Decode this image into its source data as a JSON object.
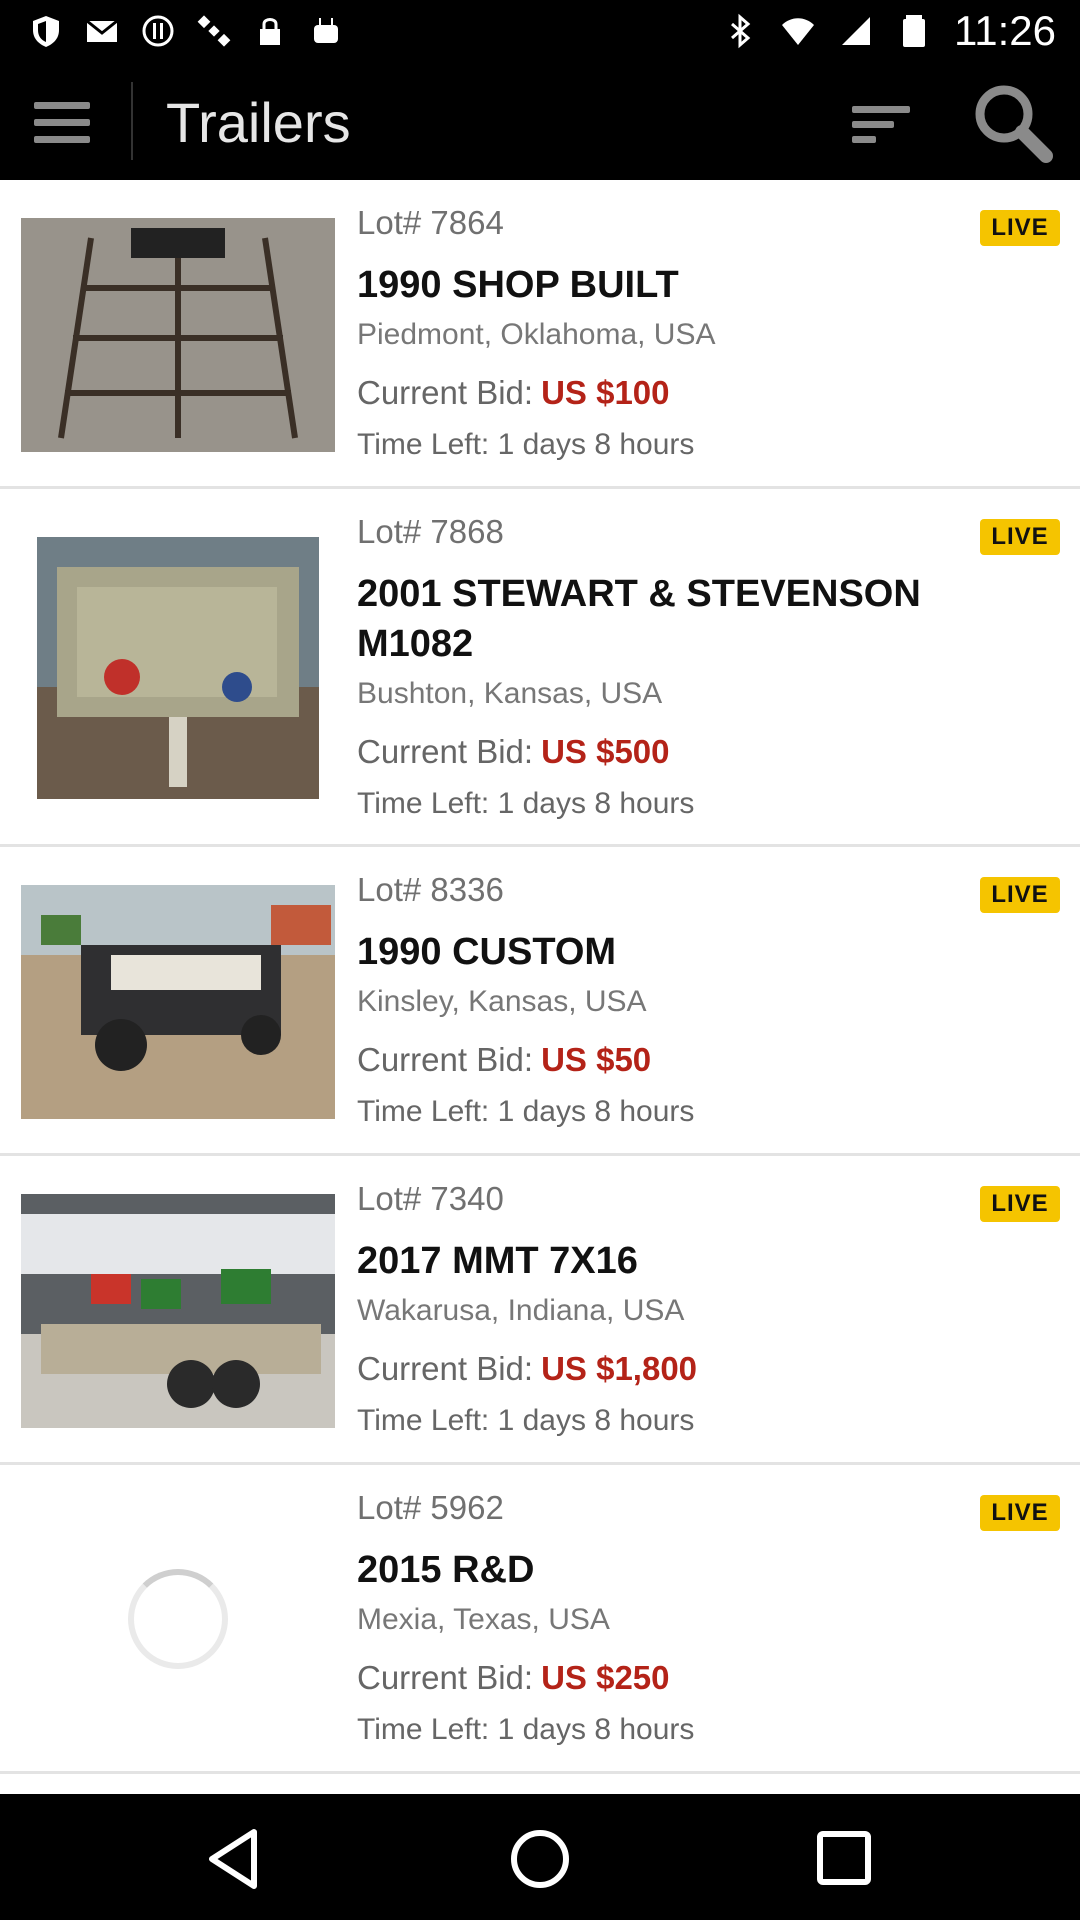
{
  "status_bar": {
    "time": "11:26",
    "left_icons": [
      "shield-icon",
      "mail-icon",
      "alert-icon",
      "satellite-icon",
      "lock-icon",
      "android-icon"
    ],
    "right_icons": [
      "bluetooth-icon",
      "wifi-icon",
      "signal-icon",
      "battery-icon"
    ]
  },
  "app_bar": {
    "title": "Trailers",
    "menu_icon": "hamburger-menu-icon",
    "sort_icon": "sort-icon",
    "search_icon": "search-icon"
  },
  "items": [
    {
      "lot": "Lot# 7864",
      "title": "1990 SHOP BUILT",
      "location": "Piedmont, Oklahoma, USA",
      "bid_label": "Current Bid:",
      "bid_amount": "US $100",
      "time_left": "Time Left: 1 days 8 hours",
      "badge": "LIVE"
    },
    {
      "lot": "Lot# 7868",
      "title": "2001 STEWART & STEVENSON M1082",
      "location": "Bushton, Kansas, USA",
      "bid_label": "Current Bid:",
      "bid_amount": "US $500",
      "time_left": "Time Left: 1 days 8 hours",
      "badge": "LIVE"
    },
    {
      "lot": "Lot# 8336",
      "title": "1990 CUSTOM",
      "location": "Kinsley, Kansas, USA",
      "bid_label": "Current Bid:",
      "bid_amount": "US $50",
      "time_left": "Time Left: 1 days 8 hours",
      "badge": "LIVE"
    },
    {
      "lot": "Lot# 7340",
      "title": "2017 MMT 7X16",
      "location": "Wakarusa, Indiana, USA",
      "bid_label": "Current Bid:",
      "bid_amount": "US $1,800",
      "time_left": "Time Left: 1 days 8 hours",
      "badge": "LIVE"
    },
    {
      "lot": "Lot# 5962",
      "title": "2015 R&D",
      "location": "Mexia, Texas, USA",
      "bid_label": "Current Bid:",
      "bid_amount": "US $250",
      "time_left": "Time Left: 1 days 8 hours",
      "badge": "LIVE"
    }
  ],
  "nav_bar": {
    "icons": [
      "back-icon",
      "home-icon",
      "recents-icon"
    ]
  },
  "colors": {
    "bid_amount": "#b42318",
    "live_badge": "#f5c400",
    "bar_background": "#000000"
  }
}
